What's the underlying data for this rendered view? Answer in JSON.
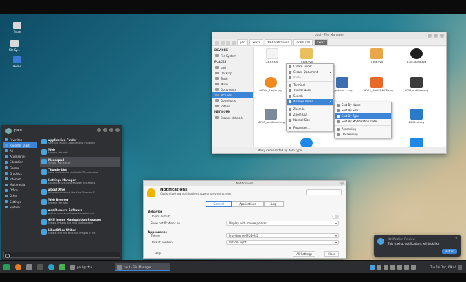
{
  "desktop_icons": [
    {
      "label": "Trash"
    },
    {
      "label": "File Sy..."
    },
    {
      "label": "Home"
    }
  ],
  "file_manager": {
    "title": "pacl - File Manager",
    "breadcrumbs": [
      "pacl",
      "xxxxx",
      "Xa-Calabrasona",
      "1280x720",
      "xxxxx"
    ],
    "sidebar": {
      "devices_header": "DEVICES",
      "devices": [
        "File System"
      ],
      "places_header": "PLACES",
      "places": [
        "pacl",
        "Desktop",
        "Trash",
        "Music",
        "Documents",
        "Pictures",
        "Downloads",
        "Videos"
      ],
      "selected_place": "Pictures",
      "network_header": "NETWORK",
      "network": [
        "Browse Network"
      ]
    },
    "files": [
      {
        "name": "73-83.svg",
        "color": "#ffffff"
      },
      {
        "name": "7-top.svg",
        "color": "#e8c060"
      },
      {
        "name": "7-top.svg",
        "color": "#e8a84a"
      },
      {
        "name": "8-bit-stand.svg",
        "color": "#1e1e1e"
      },
      {
        "name": "9000a_Single.svg",
        "color": "#f08a1e"
      },
      {
        "name": "a_python-4.svg",
        "color": "#3b6fb0"
      },
      {
        "name": "9003_POWERMC8.svg",
        "color": "#e86a2a"
      },
      {
        "name": "9004_sublime.svg",
        "color": "#3b3b3b"
      },
      {
        "name": "6765_additional.svg",
        "color": "#7a8a9a"
      },
      {
        "name": "",
        "color": "#1e88e5"
      },
      {
        "name": "",
        "color": "#1e88e5"
      },
      {
        "name": "2048-pt.svg",
        "color": "#2a7ac8"
      }
    ],
    "status": "Many items sorted by Item type"
  },
  "context_menu": {
    "items": [
      {
        "label": "Create Folder..."
      },
      {
        "label": "Create Document",
        "submenu": true
      },
      {
        "label": "Paste",
        "dim": true
      },
      {
        "sep": true
      },
      {
        "label": "Terminal"
      },
      {
        "label": "Thunar Here"
      },
      {
        "label": "Search"
      },
      {
        "label": "Arrange Items",
        "submenu": true,
        "selected": true
      },
      {
        "sep": true
      },
      {
        "label": "Zoom In"
      },
      {
        "label": "Zoom Out"
      },
      {
        "label": "Normal Size"
      },
      {
        "sep": true
      },
      {
        "label": "Properties..."
      }
    ]
  },
  "sort_menu": {
    "items": [
      {
        "label": "Sort By Name"
      },
      {
        "label": "Sort By Size"
      },
      {
        "label": "Sort By Type",
        "selected": true
      },
      {
        "label": "Sort By Modification Date"
      },
      {
        "sep": true
      },
      {
        "label": "Ascending"
      },
      {
        "label": "Descending"
      }
    ]
  },
  "whisker_menu": {
    "user": "paul",
    "search_placeholder": "",
    "categories": [
      {
        "label": "Favorites"
      },
      {
        "label": "Recently Used",
        "selected": true
      },
      {
        "label": "All"
      },
      {
        "label": "Accessories"
      },
      {
        "label": "Education"
      },
      {
        "label": "Games"
      },
      {
        "label": "Graphics"
      },
      {
        "label": "Internet"
      },
      {
        "label": "Multimedia"
      },
      {
        "label": "Office"
      },
      {
        "label": "Other"
      },
      {
        "label": "Settings"
      },
      {
        "label": "System"
      }
    ],
    "apps": [
      {
        "name": "Application Finder",
        "desc": "Find and launch applications installed"
      },
      {
        "name": "Web",
        "desc": "Browse the web"
      },
      {
        "name": "Mousepad",
        "desc": "Simple Text Editor",
        "selected": true
      },
      {
        "name": "Thunderbird",
        "desc": "Send and receive mail with Thunderbird"
      },
      {
        "name": "Settings Manager",
        "desc": "Graphical Settings Manager for Xfce 4"
      },
      {
        "name": "About Xfce",
        "desc": "Information about the Xfce Desktop E"
      },
      {
        "name": "Web Browser",
        "desc": "Browse the web"
      },
      {
        "name": "Add/Remove Software",
        "desc": "Add or remove software installed on t"
      },
      {
        "name": "GNU Image Manipulation Program",
        "desc": "Create images and edit photographs"
      },
      {
        "name": "LibreOffice Writer",
        "desc": "Create and edit text and images in let"
      }
    ]
  },
  "notifications_dialog": {
    "window_title": "Notifications",
    "title": "Notifications",
    "subtitle": "Customize how notifications appear on your screen",
    "tabs": [
      {
        "label": "General",
        "selected": true
      },
      {
        "label": "Applications"
      },
      {
        "label": "Log"
      }
    ],
    "behavior_header": "Behavior",
    "do_not_disturb_label": "Do not disturb",
    "show_on_label": "Show notifications on",
    "show_on_value": "Display with mouse pointer",
    "appearance_header": "Appearance",
    "theme_label": "Theme",
    "theme_value": "Prof-Gnome-MOD-3.5",
    "position_label": "Default position",
    "position_value": "Bottom right",
    "help_label": "Help",
    "all_settings_label": "All Settings",
    "close_label": "Close"
  },
  "notification_popup": {
    "title": "Notification Preview",
    "body": "This is what notifications will look like",
    "button": "Button"
  },
  "taskbar": {
    "tasks": [
      {
        "label": "paul@xfce"
      },
      {
        "label": "paul - File Manager",
        "active": true
      }
    ],
    "clock": "Tue 16 Dec, 09:44"
  }
}
